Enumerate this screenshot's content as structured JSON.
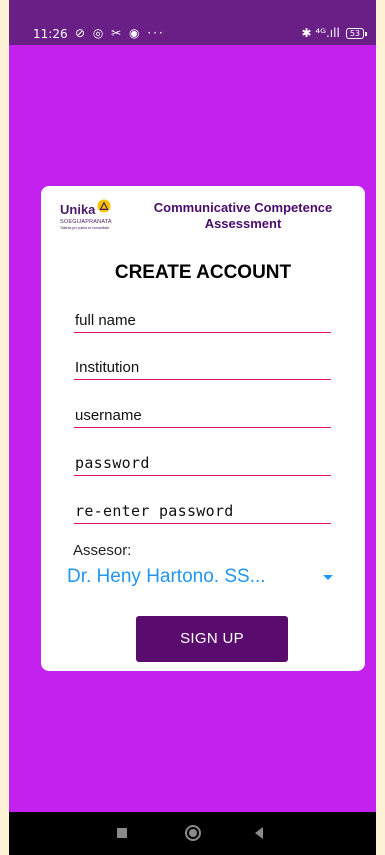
{
  "status_bar": {
    "time": "11:26",
    "left_icons": [
      "data-saver-icon",
      "whatsapp-icon",
      "tools-icon",
      "messenger-icon",
      "more-icon"
    ],
    "left_icons_text": "⊘ ◎ ✂ ◉ ···",
    "right_text": "✱ ⁴ᴳ.ıll",
    "battery": "53"
  },
  "card": {
    "logo_text": "Unika",
    "logo_sub": "SOEGIJAPRANATA",
    "logo_tagline": "Talenta pro patria et humanitate",
    "app_title": "Communicative Competence Assessment",
    "heading": "CREATE ACCOUNT",
    "fields": {
      "full_name": "full name",
      "institution": "Institution",
      "username": "username",
      "password": "password",
      "reenter_password": "re-enter password"
    },
    "assessor_label": "Assesor:",
    "assessor_value": "Dr. Heny Hartono. SS...",
    "signup_label": "SIGN UP"
  },
  "colors": {
    "background": "#c322ee",
    "status_bar": "#6a1f86",
    "button": "#5a0b6e",
    "underline": "#d81b60",
    "select_text": "#2196f3"
  }
}
